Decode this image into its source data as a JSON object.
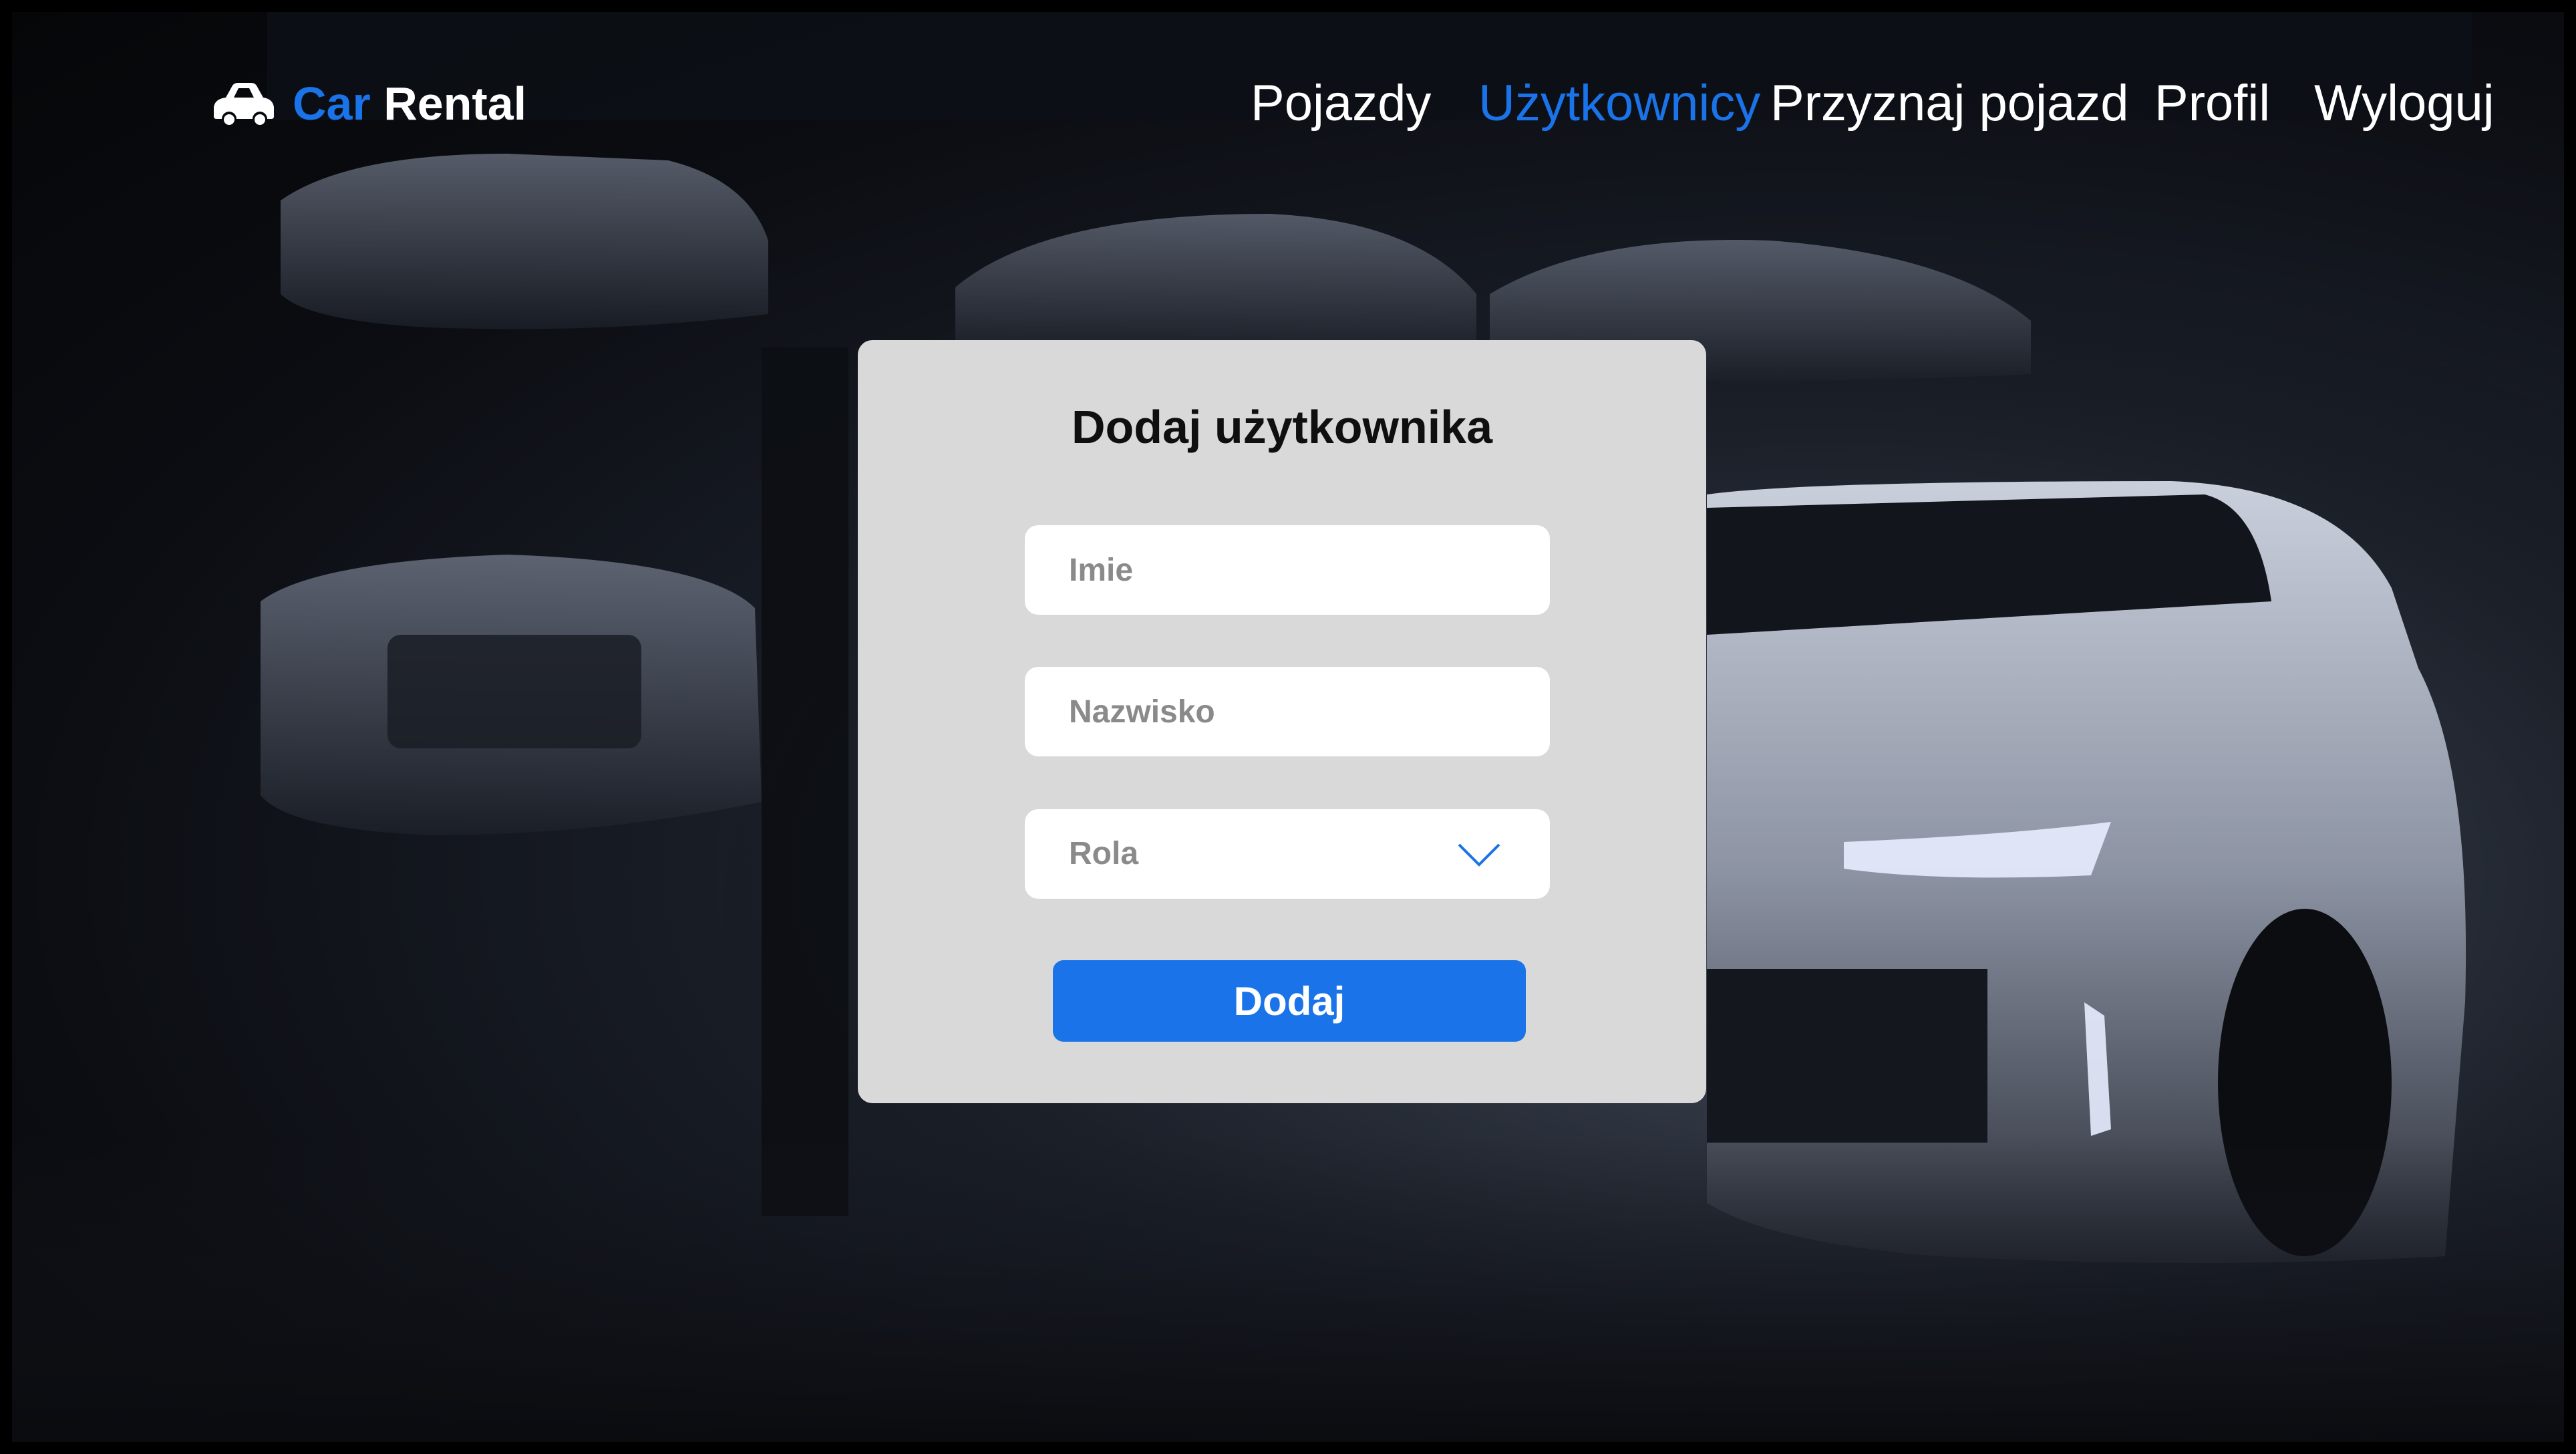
{
  "brand": {
    "accent": "Car",
    "main": "Rental",
    "icon": "car-icon"
  },
  "nav": {
    "items": [
      {
        "label": "Pojazdy",
        "active": false
      },
      {
        "label": "Użytkownicy",
        "active": true
      },
      {
        "label": "Przyznaj pojazd",
        "active": false
      },
      {
        "label": "Profil",
        "active": false
      },
      {
        "label": "Wyloguj",
        "active": false
      }
    ]
  },
  "form": {
    "title": "Dodaj użytkownika",
    "name_placeholder": "Imie",
    "surname_placeholder": "Nazwisko",
    "role_selected": "Rola",
    "role_icon": "chevron-down-icon",
    "submit_label": "Dodaj"
  },
  "colors": {
    "accent": "#1a73e8",
    "card": "#d9d9d9",
    "background": "#0b0d12"
  }
}
